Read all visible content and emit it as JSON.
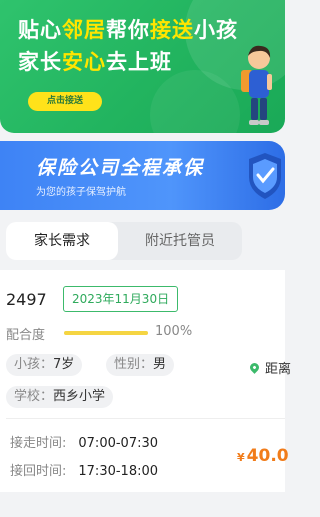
{
  "banner_top": {
    "line1_a": "贴心",
    "line1_b": "邻居",
    "line1_c": "帮你",
    "line1_d": "接送",
    "line1_e": "小孩",
    "line2_a": "家长",
    "line2_b": "安心",
    "line2_c": "去上班",
    "button_label": "点击接送"
  },
  "banner_insurance": {
    "title": "保险公司全程承保",
    "subtitle": "为您的孩子保驾护航"
  },
  "tabs": [
    {
      "label": "家长需求",
      "active": true
    },
    {
      "label": "附近托管员",
      "active": false
    }
  ],
  "order": {
    "id": "2497",
    "date": "2023年11月30日",
    "match_label": "配合度",
    "match_value": "100%",
    "match_fraction": 1.0,
    "child_key": "小孩：",
    "child_value": "7岁",
    "gender_key": "性别：",
    "gender_value": "男",
    "distance_label": "距离",
    "school_key": "学校：",
    "school_value": "西乡小学",
    "pickup_key": "接走时间:",
    "pickup_value": "07:00-07:30",
    "return_key": "接回时间:",
    "return_value": "17:30-18:00",
    "price_symbol": "¥",
    "price_value": "40.0"
  },
  "colors": {
    "brand_green": "#22b45f",
    "highlight_yellow": "#ffe500",
    "insurance_blue": "#4f95fb",
    "price_orange": "#f17c1a"
  }
}
